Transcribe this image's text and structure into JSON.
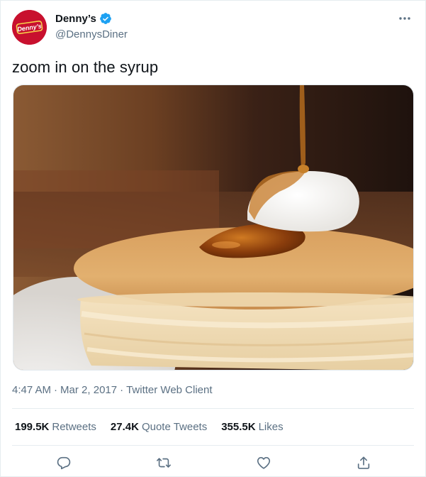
{
  "author": {
    "display_name": "Denny’s",
    "handle": "@DennysDiner",
    "avatar_text": "Denny's",
    "avatar_color": "#c8102e",
    "verified": true
  },
  "tweet": {
    "text": "zoom in on the syrup",
    "media_icon": "pancakes-with-syrup-photo"
  },
  "meta": {
    "time": "4:47 AM",
    "date": "Mar 2, 2017",
    "separator": "·",
    "source": "Twitter Web Client"
  },
  "stats": {
    "retweets_count": "199.5K",
    "retweets_label": "Retweets",
    "quotes_count": "27.4K",
    "quotes_label": "Quote Tweets",
    "likes_count": "355.5K",
    "likes_label": "Likes"
  },
  "actions": {
    "icons": [
      "reply-icon",
      "retweet-icon",
      "like-icon",
      "share-icon"
    ]
  },
  "colors": {
    "text_primary": "#0f1419",
    "text_secondary": "#5b7083",
    "verified_blue": "#1da1f2",
    "brand_red": "#c8102e",
    "action_gray": "#5b7083"
  }
}
